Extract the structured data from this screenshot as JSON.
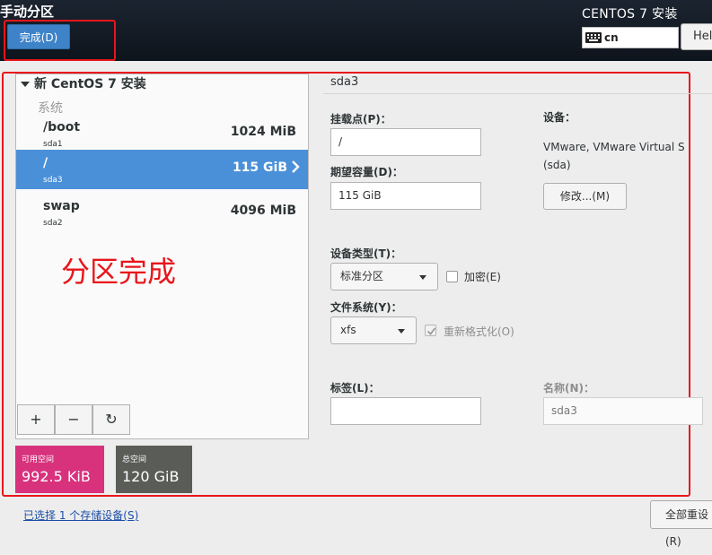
{
  "header": {
    "page_title": "手动分区",
    "done_label": "完成(D)",
    "product_title": "CENTOS 7 安装",
    "keyboard_layout": "cn",
    "help_label": "Help!"
  },
  "partitions": {
    "install_heading": "新 CentOS 7 安装",
    "system_label": "系统",
    "rows": [
      {
        "mount": "/boot",
        "device": "sda1",
        "size": "1024 MiB",
        "selected": false
      },
      {
        "mount": "/",
        "device": "sda3",
        "size": "115 GiB",
        "selected": true
      },
      {
        "mount": "swap",
        "device": "sda2",
        "size": "4096 MiB",
        "selected": false
      }
    ],
    "annotation": "分区完成",
    "toolbar": {
      "add": "+",
      "remove": "−",
      "refresh": "↻"
    }
  },
  "space": {
    "available_label": "可用空间",
    "available_value": "992.5 KiB",
    "total_label": "总空间",
    "total_value": "120 GiB",
    "colors": {
      "available": "#d8327d",
      "total": "#5a5c58"
    }
  },
  "details": {
    "device_title": "sda3",
    "mount_point_label": "挂载点(P)：",
    "mount_point_value": "/",
    "capacity_label": "期望容量(D)：",
    "capacity_value": "115 GiB",
    "device_label": "设备：",
    "device_name": "VMware, VMware Virtual S",
    "device_id": "(sda)",
    "modify_label": "修改...(M)",
    "device_type_label": "设备类型(T)：",
    "device_type_value": "标准分区",
    "encrypt_label": "加密(E)",
    "encrypt_checked": false,
    "filesystem_label": "文件系统(Y)：",
    "filesystem_value": "xfs",
    "reformat_label": "重新格式化(O)",
    "reformat_checked": true,
    "tag_label": "标签(L)：",
    "tag_value": "",
    "name_label": "名称(N)：",
    "name_value": "sda3"
  },
  "footer": {
    "storage_link": "已选择 1 个存储设备(S)",
    "reset_label": "全部重设(R)"
  }
}
